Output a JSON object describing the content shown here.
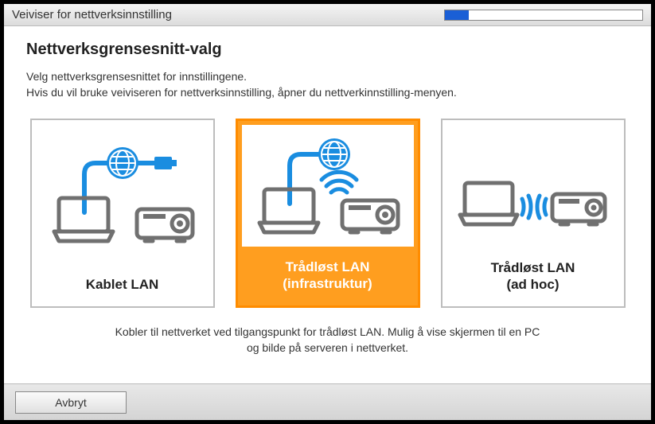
{
  "window": {
    "title": "Veiviser for nettverksinnstilling",
    "progress_percent": 12
  },
  "page": {
    "heading": "Nettverksgrensesnitt-valg",
    "sub1": "Velg nettverksgrensesnittet for innstillingene.",
    "sub2": "Hvis du vil bruke veiviseren for nettverksinnstilling, åpner du nettverkinnstilling-menyen."
  },
  "options": [
    {
      "id": "wired",
      "label": "Kablet LAN",
      "selected": false
    },
    {
      "id": "wifi-infra",
      "label": "Trådløst LAN\n(infrastruktur)",
      "selected": true
    },
    {
      "id": "wifi-adhoc",
      "label": "Trådløst LAN\n(ad hoc)",
      "selected": false
    }
  ],
  "description": {
    "line1": "Kobler til nettverket ved tilgangspunkt for trådløst LAN. Mulig å vise skjermen til en PC",
    "line2": "og bilde på serveren i nettverket."
  },
  "footer": {
    "cancel": "Avbryt"
  }
}
